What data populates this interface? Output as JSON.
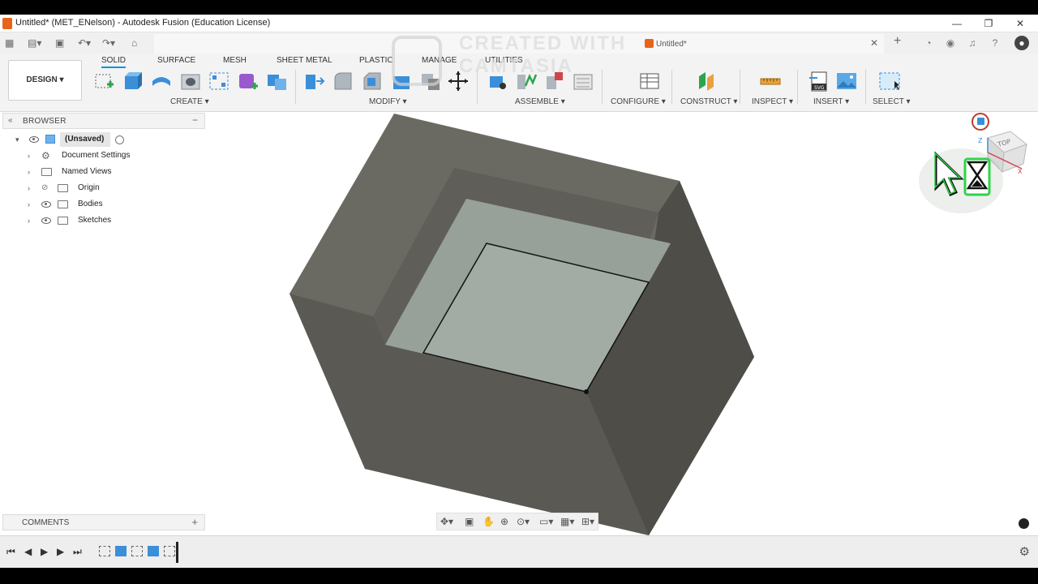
{
  "window": {
    "title": "Untitled* (MET_ENelson) - Autodesk Fusion (Education License)",
    "controls": [
      "—",
      "❐",
      "✕"
    ]
  },
  "document_tab": {
    "label": "Untitled*"
  },
  "watermark": {
    "line1": "CREATED WITH",
    "line2": "CAMTASIA"
  },
  "toolbar": {
    "workspace": "DESIGN",
    "tabs": [
      "SOLID",
      "SURFACE",
      "MESH",
      "SHEET METAL",
      "PLASTIC",
      "MANAGE",
      "UTILITIES"
    ],
    "active_tab": "SOLID",
    "groups": [
      "CREATE",
      "MODIFY",
      "ASSEMBLE",
      "CONFIGURE",
      "CONSTRUCT",
      "INSPECT",
      "INSERT",
      "SELECT"
    ]
  },
  "browser": {
    "header": "BROWSER",
    "root": "(Unsaved)",
    "items": [
      "Document Settings",
      "Named Views",
      "Origin",
      "Bodies",
      "Sketches"
    ]
  },
  "comments": {
    "header": "COMMENTS"
  },
  "viewcube": {
    "face": "TOP",
    "axis_x": "X",
    "axis_z": "Z"
  },
  "colors": {
    "accent": "#0696d7",
    "body_top": "#6b6a62",
    "body_left": "#5a5953",
    "body_right": "#4e4d48",
    "pocket_floor": "#9aa39c",
    "cursor_glow": "#2fd34a"
  },
  "icons": [
    "grid-icon",
    "file-icon",
    "save-icon",
    "undo-icon",
    "redo-icon",
    "home-icon",
    "plus-icon",
    "clock-icon",
    "bell-icon",
    "help-icon",
    "user-icon"
  ]
}
